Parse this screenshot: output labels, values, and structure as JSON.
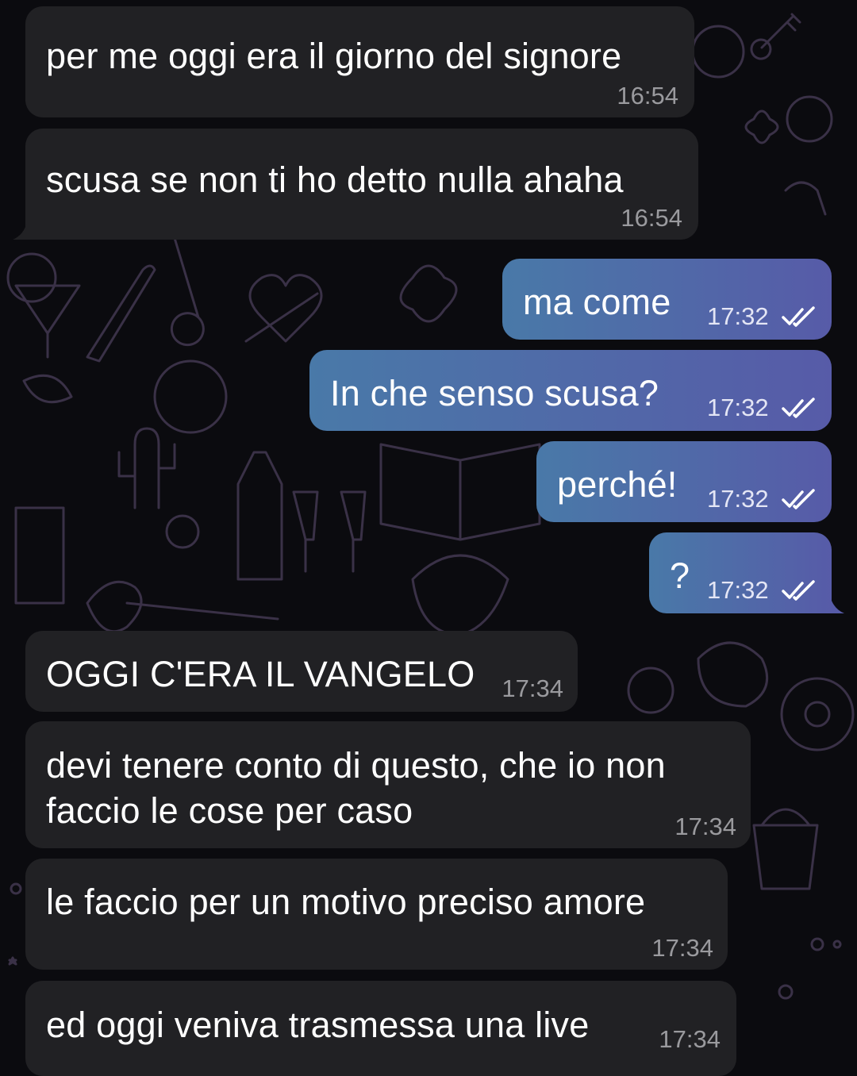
{
  "theme": {
    "background": "#0b0b0f",
    "incoming_bubble": "#212124",
    "outgoing_gradient": [
      "#4979a8",
      "#575ba8"
    ],
    "time_incoming": "#9a9a9e",
    "doodle_stroke": "#3a3147"
  },
  "messages": [
    {
      "direction": "incoming",
      "text": "per me oggi era il giorno del signore",
      "time": "16:54"
    },
    {
      "direction": "incoming",
      "text": "scusa se non ti ho detto nulla ahaha",
      "time": "16:54"
    },
    {
      "direction": "outgoing",
      "text": "ma come",
      "time": "17:32",
      "status": "read-double-check-icon"
    },
    {
      "direction": "outgoing",
      "text": "In che senso scusa?",
      "time": "17:32",
      "status": "read-double-check-icon"
    },
    {
      "direction": "outgoing",
      "text": "perché!",
      "time": "17:32",
      "status": "read-double-check-icon"
    },
    {
      "direction": "outgoing",
      "text": "?",
      "time": "17:32",
      "status": "read-double-check-icon"
    },
    {
      "direction": "incoming",
      "text": "OGGI C'ERA IL VANGELO",
      "time": "17:34"
    },
    {
      "direction": "incoming",
      "lines": [
        "devi tenere conto di questo, che io non",
        "faccio le cose per caso"
      ],
      "time": "17:34"
    },
    {
      "direction": "incoming",
      "text": "le faccio per un motivo preciso amore",
      "time": "17:34"
    },
    {
      "direction": "incoming",
      "text": "ed oggi veniva trasmessa una live",
      "time": "17:34"
    }
  ]
}
